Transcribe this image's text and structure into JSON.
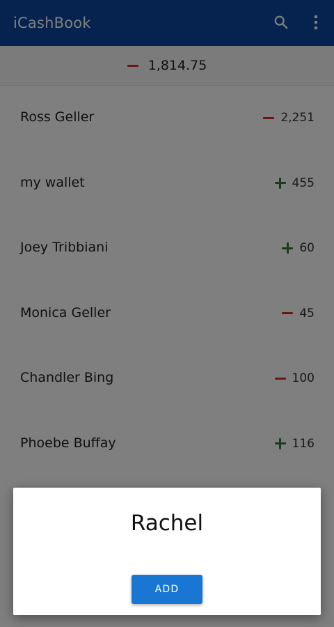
{
  "app": {
    "title": "iCashBook"
  },
  "toolbar": {
    "search_icon": "search-icon",
    "more_icon": "more-vert-icon"
  },
  "summary": {
    "sign": "minus",
    "total": "1,814.75"
  },
  "accounts": [
    {
      "name": "Ross Geller",
      "sign": "minus",
      "amount": "2,251"
    },
    {
      "name": "my wallet",
      "sign": "plus",
      "amount": "455"
    },
    {
      "name": "Joey Tribbiani",
      "sign": "plus",
      "amount": "60"
    },
    {
      "name": "Monica Geller",
      "sign": "minus",
      "amount": "45"
    },
    {
      "name": "Chandler Bing",
      "sign": "minus",
      "amount": "100"
    },
    {
      "name": "Phoebe Buffay",
      "sign": "plus",
      "amount": "116"
    }
  ],
  "dialog": {
    "name": "Rachel",
    "add_label": "ADD"
  },
  "colors": {
    "appbar": "#0d47a1",
    "negative": "#d32f2f",
    "positive": "#2e7d32",
    "button": "#1976d2"
  }
}
